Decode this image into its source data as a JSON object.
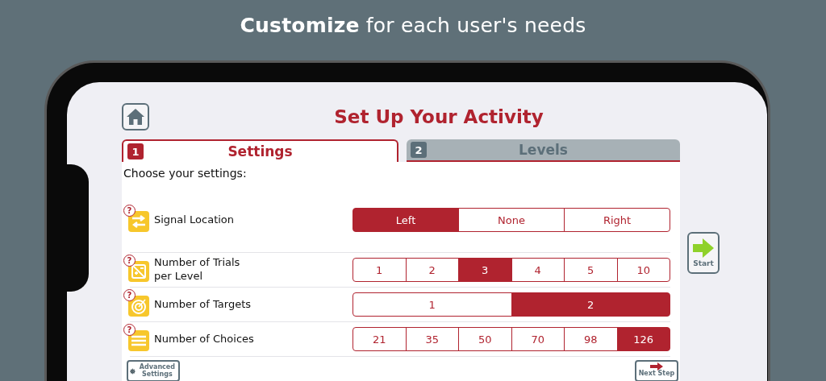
{
  "headline": "**Customize** for each user's needs",
  "title": "Set Up Your Activity",
  "tabs": [
    {
      "number": "1",
      "label": "Settings",
      "selected": true
    },
    {
      "number": "2",
      "label": "Levels",
      "selected": false
    }
  ],
  "prompt": "Choose your settings:",
  "settings": [
    {
      "help": "?",
      "label": "Signal Location",
      "options": [
        {
          "label": "Left",
          "selected": true
        },
        {
          "label": "None",
          "selected": false
        },
        {
          "label": "Right",
          "selected": false
        }
      ]
    },
    {
      "help": "?",
      "label": "Number of Trials\nper Level",
      "options": [
        {
          "label": "1",
          "selected": false
        },
        {
          "label": "2",
          "selected": false
        },
        {
          "label": "3",
          "selected": true
        },
        {
          "label": "4",
          "selected": false
        },
        {
          "label": "5",
          "selected": false
        },
        {
          "label": "10",
          "selected": false
        }
      ]
    },
    {
      "help": "?",
      "label": "Number of Targets",
      "options": [
        {
          "label": "1",
          "selected": false
        },
        {
          "label": "2",
          "selected": true
        }
      ]
    },
    {
      "help": "?",
      "label": "Number of Choices",
      "options": [
        {
          "label": "21",
          "selected": false
        },
        {
          "label": "35",
          "selected": false
        },
        {
          "label": "50",
          "selected": false
        },
        {
          "label": "70",
          "selected": false
        },
        {
          "label": "98",
          "selected": false
        },
        {
          "label": "126",
          "selected": true
        }
      ]
    }
  ],
  "advanced_button": "Advanced Settings",
  "next_button": "Next Step",
  "start_button": "Start"
}
